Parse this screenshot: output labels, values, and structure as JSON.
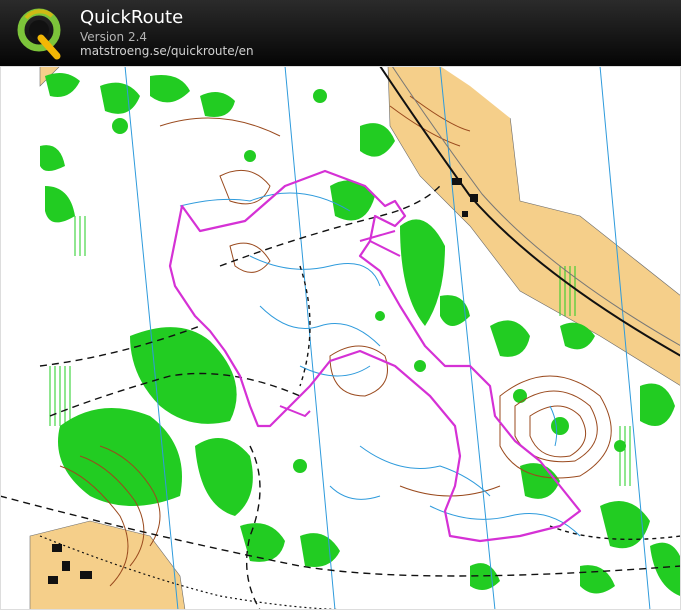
{
  "app": {
    "title": "QuickRoute",
    "version": "Version 2.4",
    "url": "matstroeng.se/quickroute/en"
  },
  "colors": {
    "banner": "#111111",
    "map_background": "#ffffff",
    "vegetation": "#22cc22",
    "open_land": "#f5cf8a",
    "contour": "#9a4a1e",
    "water": "#2f9bdc",
    "route": "#d531d5",
    "path": "#111111",
    "logo_ring": "#7cc43a",
    "logo_q": "#f2b705"
  },
  "icons": {
    "logo": "quickroute-q-logo"
  }
}
